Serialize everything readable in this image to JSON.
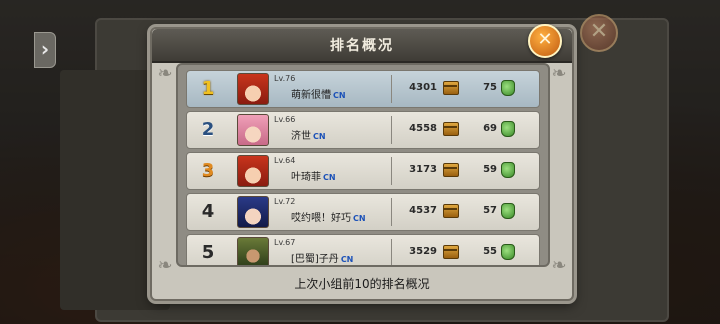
{
  "dialog": {
    "title": "排名概况",
    "close_label": "✕",
    "footer": "上次小组前10的排名概况"
  },
  "side_arrow_label": "›",
  "colors": {
    "rank_gold": "#f0c020",
    "rank_silver": "#2a5080",
    "rank_bronze": "#e08a20",
    "cn_tag": "#1d52b8",
    "highlight_row": "#c6d3da"
  },
  "rows": [
    {
      "rank": "1",
      "level": "Lv.76",
      "name": "萌新很懵",
      "server": "CN",
      "power": "4301",
      "score": "75",
      "avatar": "red-hair-girl-avatar-icon",
      "medal": "gold",
      "highlight": true
    },
    {
      "rank": "2",
      "level": "Lv.66",
      "name": "济世",
      "server": "CN",
      "power": "4558",
      "score": "69",
      "avatar": "pink-hair-girl-avatar-icon",
      "medal": "silver",
      "highlight": false
    },
    {
      "rank": "3",
      "level": "Lv.64",
      "name": "叶琦菲",
      "server": "CN",
      "power": "3173",
      "score": "59",
      "avatar": "red-hair-girl-avatar-icon",
      "medal": "bronze",
      "highlight": false
    },
    {
      "rank": "4",
      "level": "Lv.72",
      "name": "哎约喂！好巧",
      "server": "CN",
      "power": "4537",
      "score": "57",
      "avatar": "blue-hair-girl-avatar-icon",
      "medal": "plain",
      "highlight": false
    },
    {
      "rank": "5",
      "level": "Lv.67",
      "name": "[巴蜀]子丹",
      "server": "CN",
      "power": "3529",
      "score": "55",
      "avatar": "green-armored-warrior-avatar-icon",
      "medal": "plain",
      "highlight": false
    }
  ]
}
